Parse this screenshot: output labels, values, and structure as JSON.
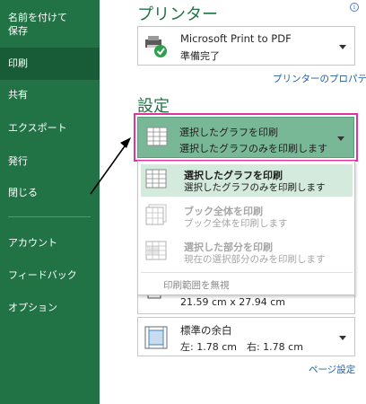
{
  "sidebar": {
    "items": [
      {
        "label_line1": "名前を付けて",
        "label_line2": "保存"
      },
      {
        "label": "印刷"
      },
      {
        "label": "共有"
      },
      {
        "label": "エクスポート"
      },
      {
        "label": "発行"
      },
      {
        "label": "閉じる"
      },
      {
        "label": "アカウント"
      },
      {
        "label": "フィードバック"
      },
      {
        "label": "オプション"
      }
    ]
  },
  "printer": {
    "section_title": "プリンター",
    "info_glyph": "i",
    "name": "Microsoft Print to PDF",
    "status": "準備完了",
    "properties_link": "プリンターのプロパティ"
  },
  "settings": {
    "section_title": "設定",
    "selected": {
      "title": "選択したグラフを印刷",
      "desc": "選択したグラフのみを印刷します"
    },
    "menu": {
      "items": [
        {
          "title": "選択したグラフを印刷",
          "desc": "選択したグラフのみを印刷します"
        },
        {
          "title": "ブック全体を印刷",
          "desc": "ブック全体を印刷します"
        },
        {
          "title": "選択した部分を印刷",
          "desc": "現在の選択部分のみを印刷します"
        }
      ],
      "footer": "印刷範囲を無視"
    },
    "paper_size": "21.59 cm x 27.94 cm",
    "margins": {
      "title": "標準の余白",
      "detail": "左: 1.78 cm　右: 1.78 cm"
    },
    "page_setup_link": "ページ設定"
  },
  "colors": {
    "sidebar": "#217346",
    "sidebar_active": "#185c37",
    "accent_green": "#217346",
    "selected_bg": "#79b896",
    "highlight_border": "#e0339c",
    "link": "#1f5fa8"
  }
}
